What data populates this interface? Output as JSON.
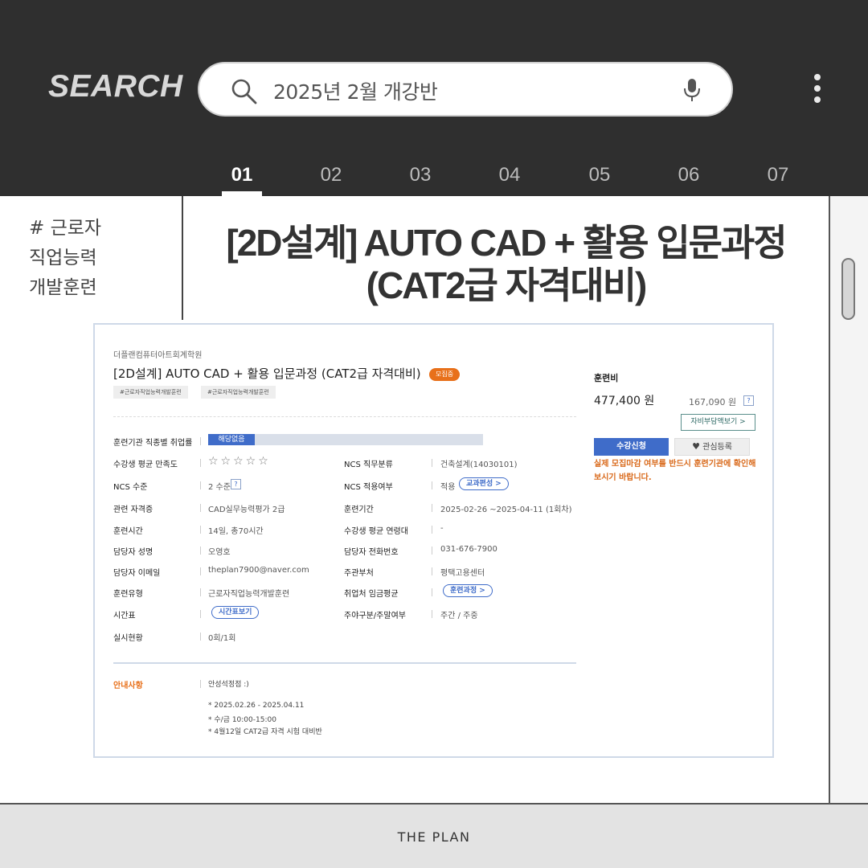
{
  "header": {
    "search_word": "SEARCH",
    "query": "2025년 2월 개강반",
    "tabs": [
      "01",
      "02",
      "03",
      "04",
      "05",
      "06",
      "07"
    ],
    "active_tab": "01"
  },
  "side": {
    "tag_line1": "# 근로자",
    "tag_line2": "직업능력",
    "tag_line3": "개발훈련"
  },
  "main": {
    "title_line1": "[2D설계] AUTO CAD + 활용 입문과정",
    "title_line2": "(CAT2급 자격대비)"
  },
  "card": {
    "institution": "더플랜컴퓨터아트회계학원",
    "course_title": "[2D설계] AUTO CAD + 활용 입문과정 (CAT2급 자격대비)",
    "status_badge": "모집중",
    "chips": [
      "#근로자직업능력개발훈련",
      "#근로자직업능력개발훈련"
    ],
    "rows": {
      "employment_label": "훈련기관 직종별 취업률",
      "employment_value": "해당없음",
      "satisfaction_label": "수강생 평균 만족도",
      "stars": "☆☆☆☆☆",
      "ncs_class_label": "NCS 직무분류",
      "ncs_class_value": "건축설계(14030101)",
      "ncs_level_label": "NCS 수준",
      "ncs_level_value": "2 수준",
      "ncs_apply_label": "NCS 적용여부",
      "ncs_apply_value": "적용",
      "curriculum_button": "교과편성 >",
      "cert_label": "관련 자격증",
      "cert_value": "CAD실무능력평가 2급",
      "period_label": "훈련기간",
      "period_value": "2025-02-26 ~2025-04-11 (1회차)",
      "hours_label": "훈련시간",
      "hours_value": "14일, 총70시간",
      "age_label": "수강생 평균 연령대",
      "age_value": "-",
      "manager_label": "담당자 성명",
      "manager_value": "오영호",
      "phone_label": "담당자 전화번호",
      "phone_value": "031-676-7900",
      "email_label": "담당자 이메일",
      "email_value": "theplan7900@naver.com",
      "dept_label": "주관부처",
      "dept_value": "평택고용센터",
      "type_label": "훈련유형",
      "type_value": "근로자직업능력개발훈련",
      "wage_label": "취업처 임금평균",
      "course_button": "훈련과정 >",
      "schedule_label": "시간표",
      "schedule_button": "시간표보기",
      "daynight_label": "주야구분/주말여부",
      "daynight_value": "주간 / 주중",
      "status_label": "실시현황",
      "status_value": "0회/1회"
    },
    "notice": {
      "label": "안내사항",
      "line1": "안성석정점 :)",
      "line2": "* 2025.02.26 - 2025.04.11",
      "line3": "* 수/금 10:00-15:00",
      "line4": "* 4월12일 CAT2급 자격 시험 대비반"
    },
    "fee": {
      "label": "훈련비",
      "amount": "477,400 원",
      "self_amount": "167,090 원",
      "self_pay_button": "자비부담액보기 >",
      "apply_button": "수강신청",
      "wish_button": "관심등록",
      "warning": "실제 모집마감 여부를 반드시 훈련기관에 확인해보시기 바랍니다."
    }
  },
  "footer": {
    "text": "THE PLAN"
  }
}
